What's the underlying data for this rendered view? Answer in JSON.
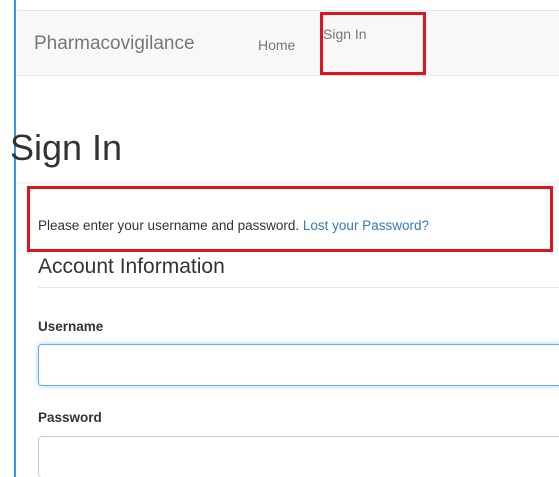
{
  "navbar": {
    "brand": "Pharmacovigilance",
    "links": [
      {
        "label": "Home"
      },
      {
        "label": "Sign In"
      }
    ]
  },
  "page": {
    "title": "Sign In"
  },
  "instruction": {
    "text": "Please enter your username and password. ",
    "link_label": "Lost your Password?"
  },
  "account_section": {
    "title": "Account Information",
    "username_label": "Username",
    "username_value": "",
    "password_label": "Password",
    "password_value": ""
  },
  "colors": {
    "highlight": "#e0141e",
    "link": "#337ab7",
    "focus": "#66afe9"
  }
}
